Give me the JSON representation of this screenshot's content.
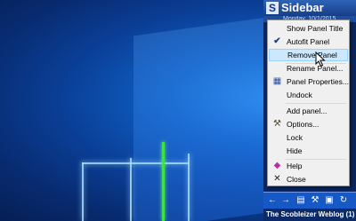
{
  "sidebar": {
    "title": "Sidebar",
    "logo_letter": "S",
    "date_text": "Monday, 10/1/2015",
    "footer_text": "The Scobleizer Weblog (1)"
  },
  "menu": {
    "items": [
      {
        "label": "Show Panel Title",
        "icon": null
      },
      {
        "label": "Autofit Panel",
        "icon": "checkmark-icon"
      },
      {
        "label": "Remove Panel",
        "icon": null,
        "highlighted": true
      },
      {
        "label": "Rename Panel...",
        "icon": null
      },
      {
        "label": "Panel Properties...",
        "icon": "panel-properties-icon"
      },
      {
        "label": "Undock",
        "icon": null
      },
      {
        "label": "Add panel...",
        "icon": null
      },
      {
        "label": "Options...",
        "icon": "tools-icon"
      },
      {
        "label": "Lock",
        "icon": null
      },
      {
        "label": "Hide",
        "icon": null
      },
      {
        "label": "Help",
        "icon": "help-book-icon"
      },
      {
        "label": "Close",
        "icon": "close-x-icon"
      }
    ]
  },
  "toolbar": {
    "icons": [
      "back-arrow-icon",
      "forward-arrow-icon",
      "panels-icon",
      "tools-icon",
      "view-icon",
      "refresh-icon"
    ]
  }
}
